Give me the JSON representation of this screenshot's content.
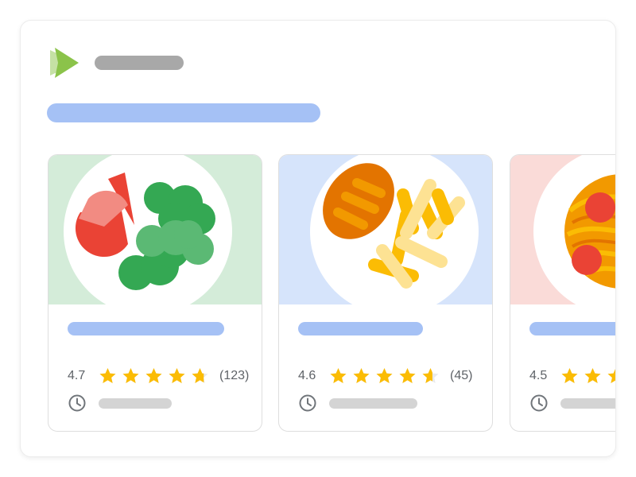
{
  "app": {
    "logo_icon": "play-logo-icon",
    "logo_colors": [
      "#8bc34a",
      "#c5e1a5"
    ],
    "placeholder_color": "#a8a8a8",
    "accent_placeholder_color": "#a5c1f5"
  },
  "cards": [
    {
      "dish_icon": "salad-icon",
      "background": "#d4ecd9",
      "rating": "4.7",
      "rating_fraction": 0.94,
      "reviews": "(123)",
      "time_icon": "clock-icon"
    },
    {
      "dish_icon": "chicken-and-fries-icon",
      "background": "#d6e4fb",
      "rating": "4.6",
      "rating_fraction": 0.92,
      "reviews": "(45)",
      "time_icon": "clock-icon"
    },
    {
      "dish_icon": "pasta-icon",
      "background": "#fadbd8",
      "rating": "4.5",
      "rating_fraction": 0.9,
      "reviews": "",
      "time_icon": "clock-icon"
    }
  ],
  "star_color": "#fbbc04",
  "star_empty_color": "#e8eaed"
}
